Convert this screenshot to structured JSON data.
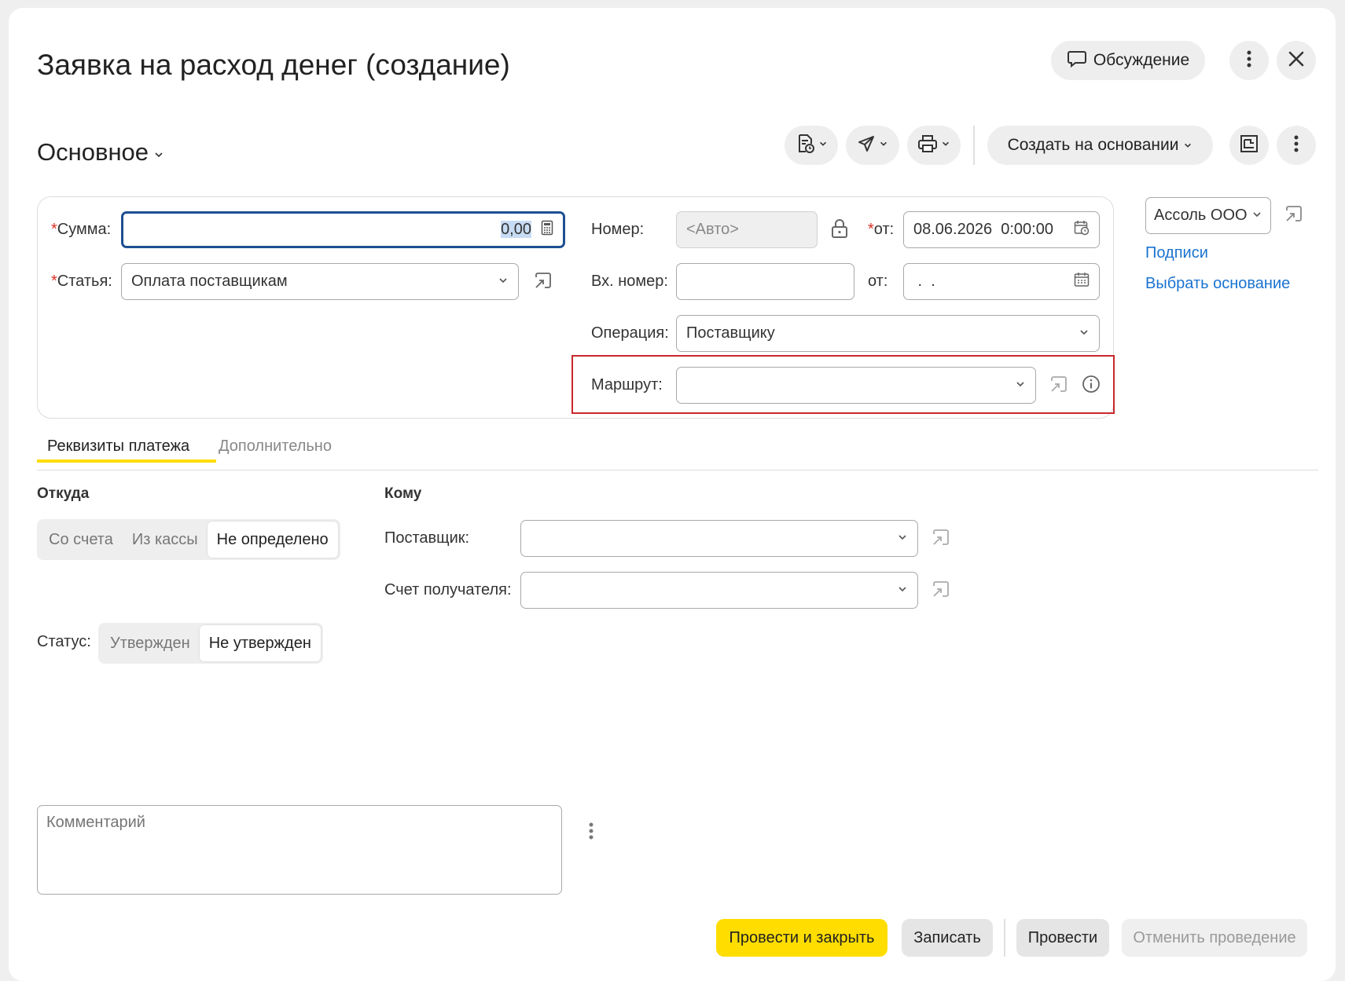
{
  "header": {
    "title": "Заявка на расход денег (создание)",
    "discussion_label": "Обсуждение"
  },
  "toolbar": {
    "section_label": "Основное",
    "create_based_label": "Создать на основании"
  },
  "form": {
    "sum_label": "Сумма:",
    "sum_value": "0,00",
    "article_label": "Статья:",
    "article_value": "Оплата поставщикам",
    "number_label": "Номер:",
    "number_placeholder": "<Авто>",
    "from_label": "от:",
    "date_value": "08.06.2026  0:00:00",
    "incoming_number_label": "Вх. номер:",
    "incoming_number_value": "",
    "incoming_from_label": "от:",
    "incoming_date_value": " .  .",
    "operation_label": "Операция:",
    "operation_value": "Поставщику",
    "route_label": "Маршрут:",
    "route_value": ""
  },
  "side": {
    "organization_value": "Ассоль ООО",
    "signatures_link": "Подписи",
    "choose_basis_link": "Выбрать основание"
  },
  "tabs": [
    {
      "label": "Реквизиты платежа",
      "active": true
    },
    {
      "label": "Дополнительно",
      "active": false
    }
  ],
  "payment": {
    "from_heading": "Откуда",
    "from_options": [
      "Со счета",
      "Из кассы",
      "Не определено"
    ],
    "from_selected": "Не определено",
    "to_heading": "Кому",
    "supplier_label": "Поставщик:",
    "supplier_value": "",
    "account_label": "Счет получателя:",
    "account_value": "",
    "status_label": "Статус:",
    "status_options": [
      "Утвержден",
      "Не утвержден"
    ],
    "status_selected": "Не утвержден"
  },
  "comment": {
    "placeholder": "Комментарий"
  },
  "footer": {
    "post_close_label": "Провести и закрыть",
    "save_label": "Записать",
    "post_label": "Провести",
    "cancel_post_label": "Отменить проведение"
  },
  "colors": {
    "accent_yellow": "#ffdd00",
    "link_blue": "#1a73d0",
    "focus_blue": "#1d4f91",
    "highlight_red": "#c8282c",
    "required_red": "#d93025"
  }
}
